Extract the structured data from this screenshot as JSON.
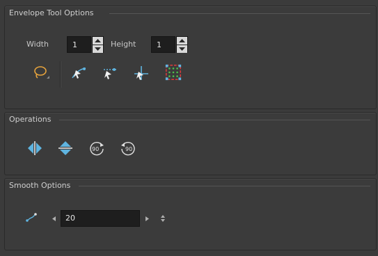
{
  "envelope": {
    "title": "Envelope Tool Options",
    "width_label": "Width",
    "width_value": "1",
    "height_label": "Height",
    "height_value": "1",
    "tools": [
      "lasso-select-icon",
      "envelope-drag-icon",
      "envelope-skew-icon",
      "envelope-cross-icon",
      "envelope-grid-icon"
    ]
  },
  "operations": {
    "title": "Operations",
    "tools": [
      "flip-horizontal-icon",
      "flip-vertical-icon",
      "rotate-90-cw-icon",
      "rotate-90-ccw-icon"
    ],
    "rotate_cw_text": "90",
    "rotate_ccw_text": "90"
  },
  "smooth": {
    "title": "Smooth Options",
    "value": "20"
  },
  "colors": {
    "background": "#3b3b3b",
    "accent_blue": "#5fb4e0",
    "lasso_yellow": "#e8a43c",
    "grid_red": "#e03a3a",
    "grid_green": "#4cc24c"
  }
}
